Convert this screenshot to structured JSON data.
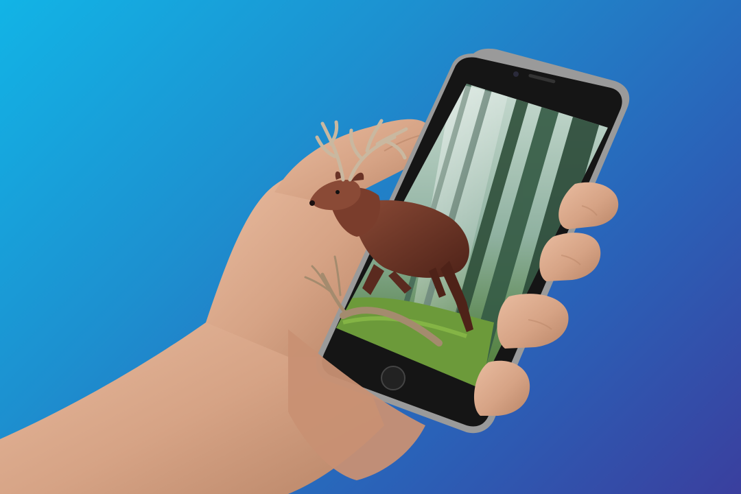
{
  "scene": {
    "description_name": "ar-deer-phone-photo",
    "background": {
      "top_left": "#12b4e6",
      "bottom_right": "#3a3f9e"
    },
    "colors": {
      "skin": "#d9a98a",
      "skin_shadow": "#b98567",
      "phone_body": "#151515",
      "phone_frame": "#9a9a9a",
      "forest_dark": "#2f4f3a",
      "forest_light": "#b9cfc3",
      "grass": "#6c9a3a",
      "deer_body": "#6a3326",
      "antler": "#c9b8a0"
    }
  }
}
